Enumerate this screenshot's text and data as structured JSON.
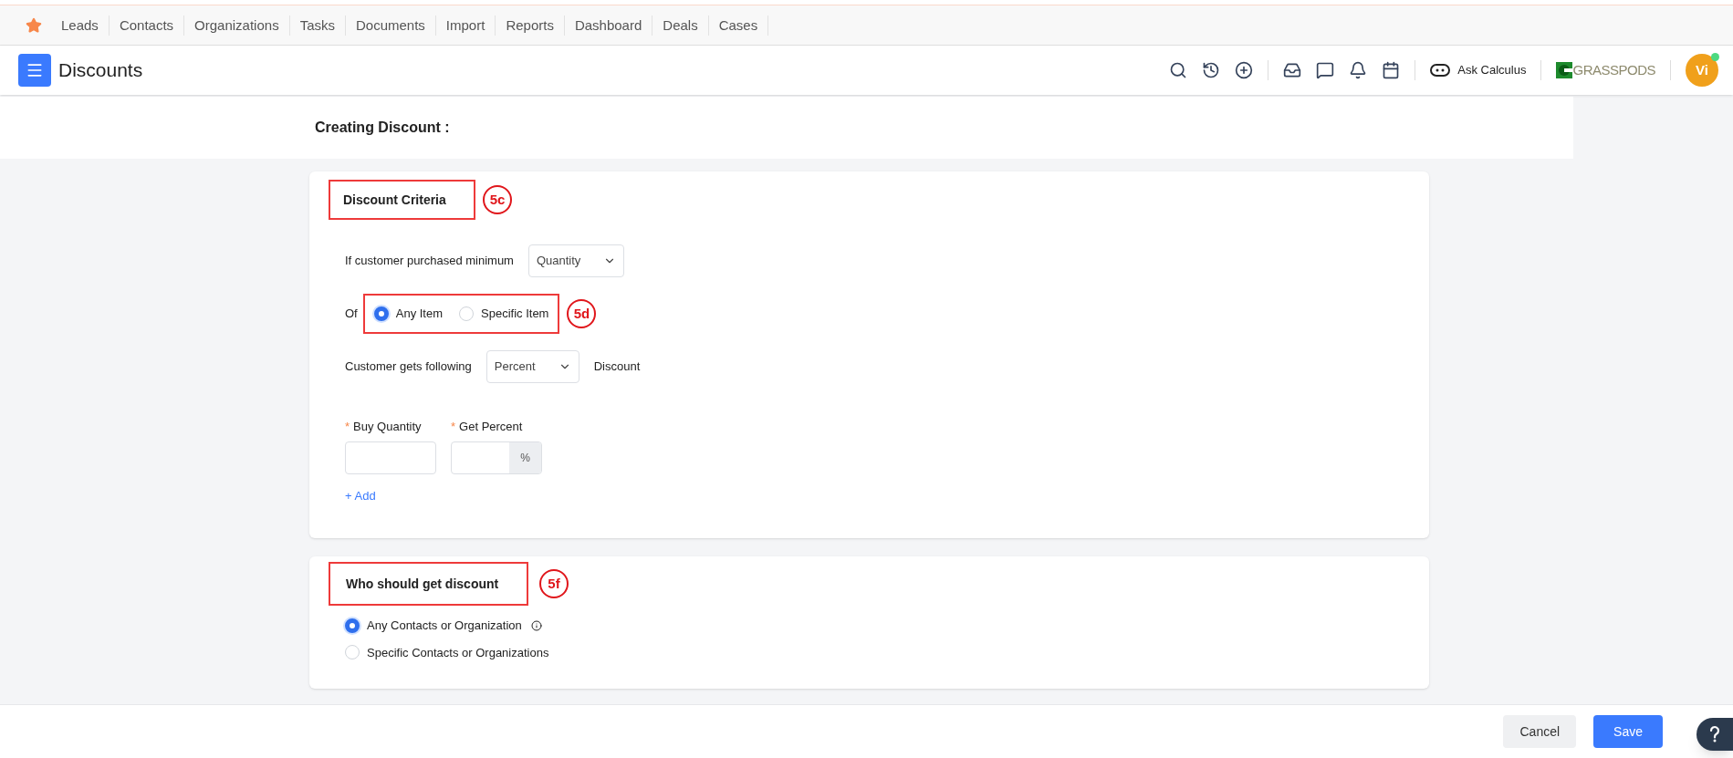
{
  "nav": {
    "items": [
      "Leads",
      "Contacts",
      "Organizations",
      "Tasks",
      "Documents",
      "Import",
      "Reports",
      "Dashboard",
      "Deals",
      "Cases"
    ]
  },
  "header": {
    "title": "Discounts",
    "ask": "Ask Calculus",
    "brand": "GRASSPODS",
    "avatar": "Vi",
    "online": true
  },
  "page_title": "Creating Discount :",
  "criteria": {
    "heading": "Discount Criteria",
    "annotation": "5c",
    "min_label": "If customer purchased minimum",
    "min_select": "Quantity",
    "of_label": "Of",
    "item_options": [
      {
        "label": "Any Item",
        "selected": true
      },
      {
        "label": "Specific Item",
        "selected": false
      }
    ],
    "item_annotation": "5d",
    "gets_label": "Customer gets following",
    "gets_select": "Percent",
    "gets_suffix": "Discount",
    "fields": [
      {
        "label": "Buy Quantity",
        "required_mark": "*"
      },
      {
        "label": "Get Percent",
        "required_mark": "*",
        "addon": "%"
      }
    ],
    "add_link": "+ Add"
  },
  "audience": {
    "heading": "Who should get discount",
    "annotation": "5f",
    "options": [
      {
        "label": "Any Contacts or Organization",
        "selected": true,
        "info": true
      },
      {
        "label": "Specific Contacts or Organizations",
        "selected": false,
        "info": false
      }
    ]
  },
  "footer": {
    "buttons": [
      {
        "label": "Cancel",
        "kind": "secondary"
      },
      {
        "label": "Save",
        "kind": "primary"
      }
    ]
  }
}
